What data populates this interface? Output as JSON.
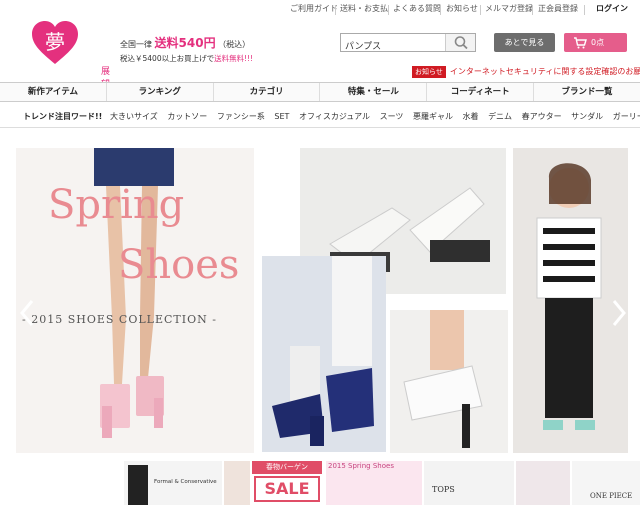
{
  "top_links": [
    "ご利用ガイド",
    "送料・お支払",
    "よくある質問",
    "お知らせ",
    "メルマガ登録",
    "正会員登録",
    "ログイン"
  ],
  "logo": {
    "text": "夢展望",
    "icon": "heart-logo-icon"
  },
  "shipping": {
    "line1_prefix": "全国一律",
    "line1_main": "送料540円",
    "line1_suffix": "（税込）",
    "line2_prefix": "税込￥5400以上お買上げで",
    "line2_highlight": "送料無料!!!"
  },
  "search": {
    "value": "パンプス",
    "icon": "search-icon"
  },
  "buttons": {
    "later": "あとで見る",
    "cart_count": "0点",
    "cart_icon": "cart-icon"
  },
  "notice": {
    "badge": "お知らせ",
    "text": "インターネットセキュリティに関する設定確認のお願い"
  },
  "main_nav": [
    "新作アイテム",
    "ランキング",
    "カテゴリ",
    "特集・セール",
    "コーディネート",
    "ブランド一覧"
  ],
  "trend": {
    "label": "トレンド注目ワード!!",
    "items": [
      "大きいサイズ",
      "カットソー",
      "ファンシー系",
      "SET",
      "オフィスカジュアル",
      "スーツ",
      "悪羅ギャル",
      "水着",
      "デニム",
      "春アウター",
      "サンダル",
      "ガーリーワンピ"
    ]
  },
  "hero": {
    "title_line1": "Spring",
    "title_line2": "Shoes",
    "subtitle": "- 2015 SHOES COLLECTION -"
  },
  "thumbs": {
    "formal": "Formal & Conservative",
    "sale_top": "春物バーゲン",
    "sale_big": "SALE",
    "spring_shoes": "2015 Spring Shoes",
    "tops": "TOPS",
    "one_piece": "ONE PIECE"
  },
  "colors": {
    "brand_pink": "#e4307e",
    "cart_pink": "#e55d8b",
    "alert_red": "#d01b23",
    "hero_title": "#e98b91"
  }
}
